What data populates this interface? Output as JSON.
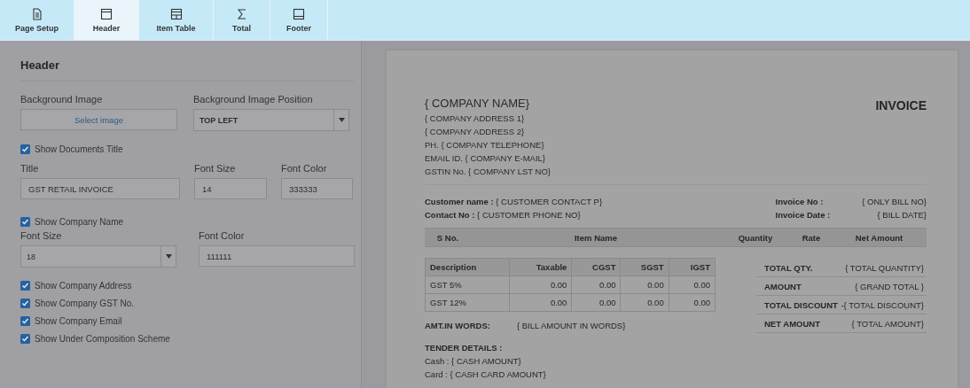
{
  "toolbar": {
    "tabs": [
      {
        "label": "Page Setup",
        "kind": "page",
        "selected": false
      },
      {
        "label": "Header",
        "kind": "header",
        "selected": true
      },
      {
        "label": "Item Table",
        "kind": "table",
        "selected": false
      },
      {
        "label": "Total",
        "kind": "sigma",
        "selected": false
      },
      {
        "label": "Footer",
        "kind": "footer",
        "selected": false
      }
    ]
  },
  "panel": {
    "title": "Header",
    "background_image": {
      "label": "Background Image",
      "button": "Select image"
    },
    "background_image_position": {
      "label": "Background Image Position",
      "value": "TOP LEFT"
    },
    "show_documents_title": {
      "label": "Show Documents Title",
      "checked": true
    },
    "title_field": {
      "label": "Title",
      "value": "GST RETAIL INVOICE"
    },
    "title_font_size": {
      "label": "Font Size",
      "value": "14"
    },
    "title_font_color": {
      "label": "Font Color",
      "value": "333333"
    },
    "show_company_name": {
      "label": "Show Company Name",
      "checked": true
    },
    "company_font_size": {
      "label": "Font Size",
      "value": "18"
    },
    "company_font_color": {
      "label": "Font Color",
      "value": "111111"
    },
    "options": [
      {
        "label": "Show Company Address",
        "checked": true
      },
      {
        "label": "Show Company GST No.",
        "checked": true
      },
      {
        "label": "Show Company Email",
        "checked": true
      },
      {
        "label": "Show Under Composition Scheme",
        "checked": true
      }
    ]
  },
  "preview": {
    "company_name": "{ COMPANY NAME}",
    "company_lines": [
      "{ COMPANY ADDRESS 1}",
      "{ COMPANY ADDRESS 2}",
      "PH. { COMPANY TELEPHONE}",
      "EMAIL ID. { COMPANY E-MAIL}",
      "GSTIN No. { COMPANY LST NO}"
    ],
    "title": "INVOICE",
    "customer": [
      {
        "label": "Customer name :",
        "value": "{ CUSTOMER CONTACT P}"
      },
      {
        "label": "Contact No :",
        "value": "{ CUSTOMER PHONE NO}"
      }
    ],
    "invoice": [
      {
        "label": "Invoice No :",
        "value": "{ ONLY BILL NO}"
      },
      {
        "label": "Invoice Date :",
        "value": "{ BILL DATE}"
      }
    ],
    "item_columns": [
      "S No.",
      "Item Name",
      "Quantity",
      "Rate",
      "Net Amount"
    ],
    "tax_table": {
      "columns": [
        "Description",
        "Taxable",
        "CGST",
        "SGST",
        "IGST"
      ],
      "rows": [
        [
          "GST 5%",
          "0.00",
          "0.00",
          "0.00",
          "0.00"
        ],
        [
          "GST 12%",
          "0.00",
          "0.00",
          "0.00",
          "0.00"
        ]
      ]
    },
    "totals": [
      {
        "label": "TOTAL QTY.",
        "value": "{ TOTAL QUANTITY}"
      },
      {
        "label": "AMOUNT",
        "value": "{ GRAND TOTAL }"
      },
      {
        "label": "TOTAL DISCOUNT",
        "value": "-{ TOTAL DISCOUNT}"
      },
      {
        "label": "NET AMOUNT",
        "value": "{ TOTAL AMOUNT}"
      }
    ],
    "amount_in_words": {
      "label": "AMT.IN WORDS:",
      "value": "{ BILL AMOUNT IN WORDS}"
    },
    "tender": {
      "title": "TENDER DETAILS :",
      "lines": [
        "Cash : { CASH AMOUNT}",
        "Card : { CASH CARD AMOUNT}"
      ]
    }
  }
}
